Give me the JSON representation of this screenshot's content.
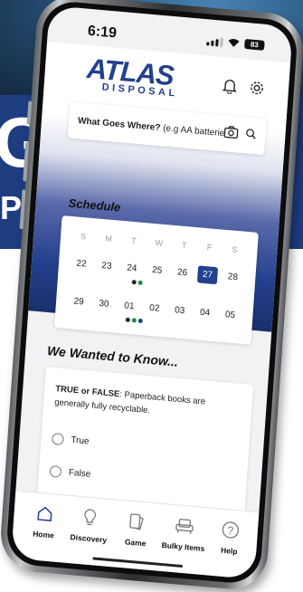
{
  "promo": {
    "big_letter": "G",
    "small_text": "P!"
  },
  "status_bar": {
    "time": "6:19",
    "battery": "83"
  },
  "header": {
    "logo_word": "ATLAS",
    "logo_sub": "DISPOSAL"
  },
  "search": {
    "label": "What Goes Where?",
    "placeholder": " (e.g AA batteries)"
  },
  "schedule": {
    "title": "Schedule",
    "weekdays": [
      "S",
      "M",
      "T",
      "W",
      "T",
      "F",
      "S"
    ],
    "week1": [
      "22",
      "23",
      "24",
      "25",
      "26",
      "27",
      "28"
    ],
    "week2": [
      "29",
      "30",
      "01",
      "02",
      "03",
      "04",
      "05"
    ],
    "selected_day": "27",
    "colors": {
      "dark": "#1f2a2a",
      "green": "#1f8a3a",
      "blue": "#23408e"
    }
  },
  "know": {
    "title": "We Wanted to Know...",
    "question_prefix": "TRUE or FALSE",
    "question_body": ": Paperback books are generally fully recyclable.",
    "options": [
      "True",
      "False"
    ]
  },
  "tabs": [
    {
      "label": "Home",
      "icon": "home-icon"
    },
    {
      "label": "Discovery",
      "icon": "lightbulb-icon"
    },
    {
      "label": "Game",
      "icon": "game-card-icon"
    },
    {
      "label": "Bulky Items",
      "icon": "armchair-icon"
    },
    {
      "label": "Help",
      "icon": "help-icon"
    }
  ],
  "accent_color": "#23408e"
}
